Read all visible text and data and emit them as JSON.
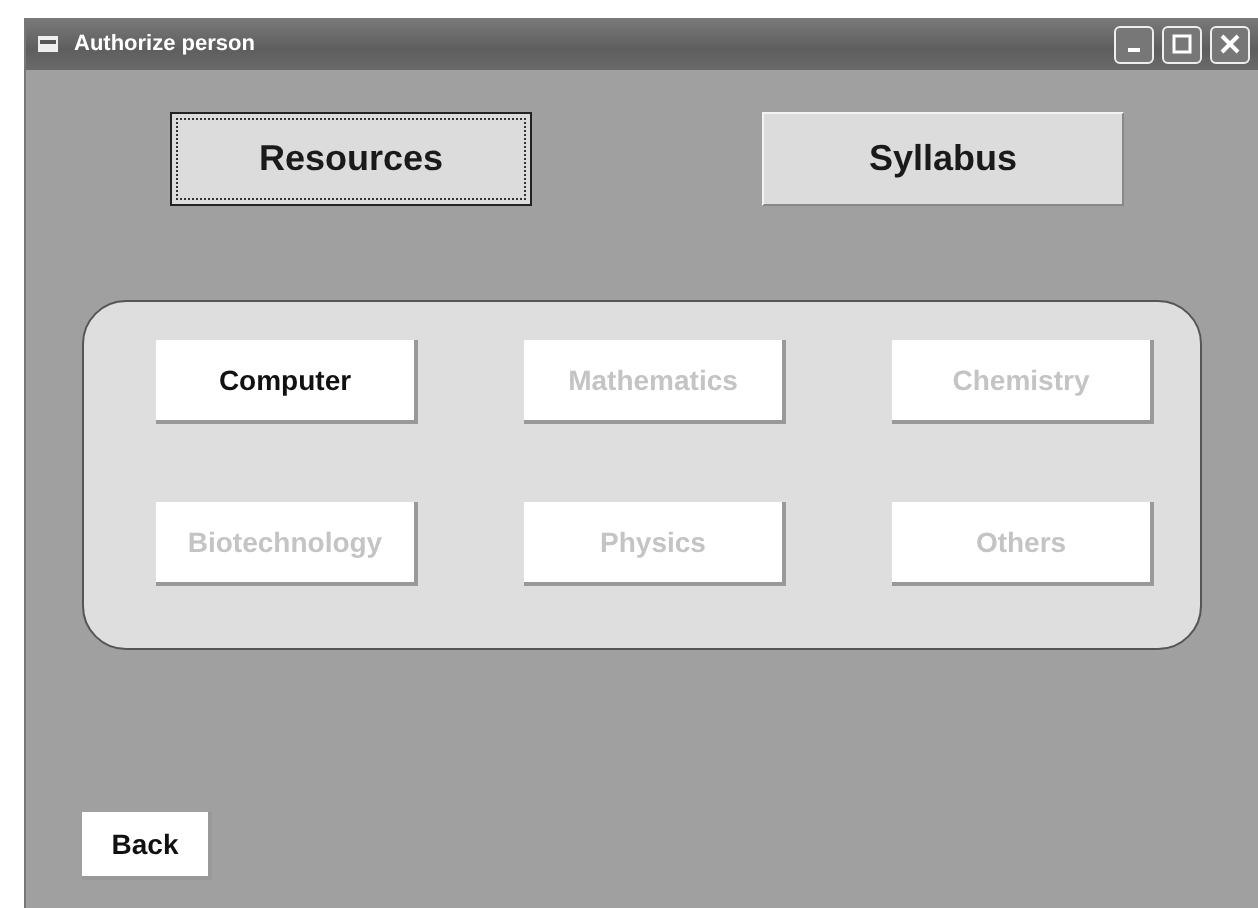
{
  "window": {
    "title": "Authorize person"
  },
  "top_buttons": [
    {
      "label": "Resources",
      "focused": true
    },
    {
      "label": "Syllabus",
      "focused": false
    }
  ],
  "subjects": [
    {
      "label": "Computer",
      "disabled": false
    },
    {
      "label": "Mathematics",
      "disabled": true
    },
    {
      "label": "Chemistry",
      "disabled": true
    },
    {
      "label": "Biotechnology",
      "disabled": true
    },
    {
      "label": "Physics",
      "disabled": true
    },
    {
      "label": "Others",
      "disabled": true
    }
  ],
  "back_button": {
    "label": "Back"
  }
}
